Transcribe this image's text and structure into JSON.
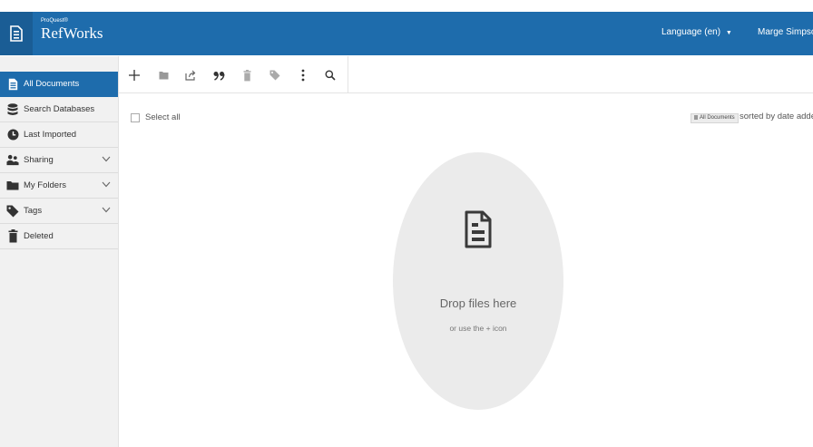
{
  "header": {
    "brand_small": "ProQuest®",
    "brand_name": "RefWorks",
    "language_label": "Language (en)",
    "language_caret": "▼",
    "user_name": "Marge Simpson"
  },
  "sidebar": {
    "items": [
      {
        "label": "All Documents",
        "icon": "document-icon"
      },
      {
        "label": "Search Databases",
        "icon": "database-icon"
      },
      {
        "label": "Last Imported",
        "icon": "clock-icon"
      },
      {
        "label": "Sharing",
        "icon": "people-icon",
        "expandable": true
      },
      {
        "label": "My Folders",
        "icon": "folder-icon",
        "expandable": true
      },
      {
        "label": "Tags",
        "icon": "tag-icon",
        "expandable": true
      },
      {
        "label": "Deleted",
        "icon": "trash-icon"
      }
    ]
  },
  "toolbar": {
    "buttons": [
      "add-icon",
      "folder-icon",
      "share-icon",
      "quote-icon",
      "trash-icon",
      "tag-icon",
      "more-icon",
      "search-icon"
    ]
  },
  "list": {
    "select_all_label": "Select all",
    "location_badge": "All Documents",
    "sort_text": "sorted by date added"
  },
  "dropzone": {
    "title": "Drop files here",
    "subtitle": "or use the + icon"
  },
  "colors": {
    "brand_blue": "#1e6cac",
    "sidebar_bg": "#f1f1f1",
    "dropzone_bg": "#ebebeb"
  }
}
